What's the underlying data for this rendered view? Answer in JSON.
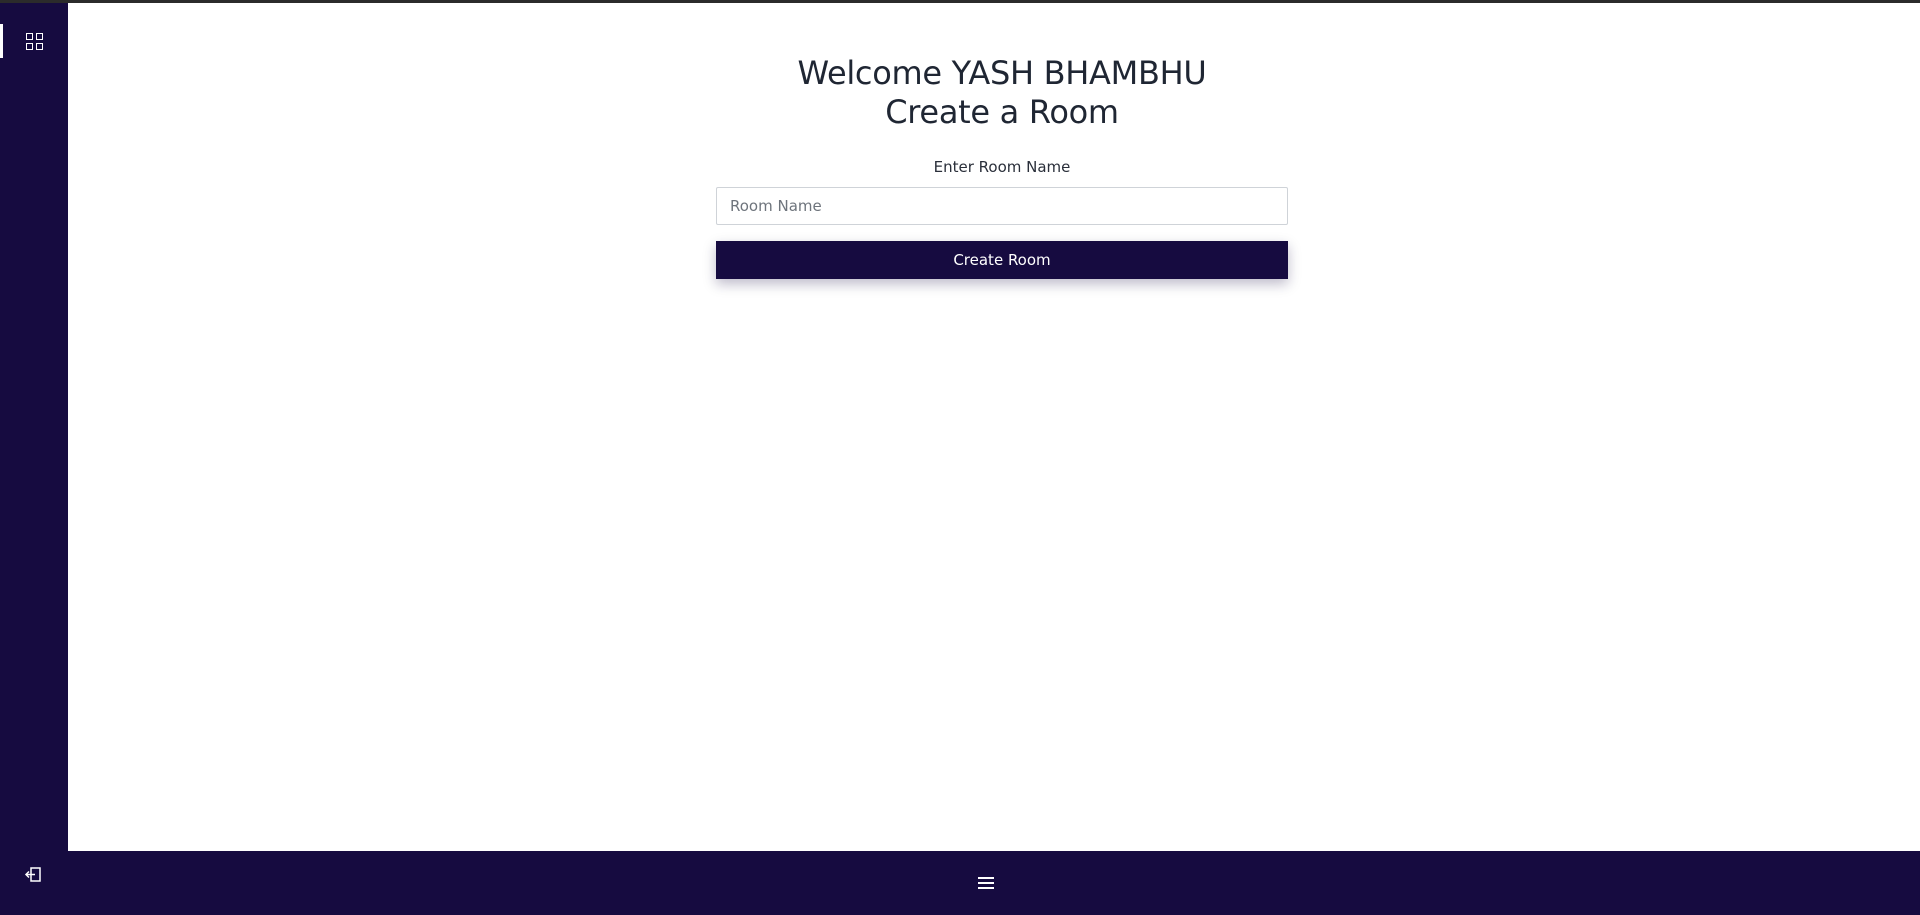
{
  "main": {
    "welcome_line": "Welcome YASH BHAMBHU",
    "heading_line": "Create a Room",
    "room_label": "Enter Room Name",
    "room_input": {
      "value": "",
      "placeholder": "Room Name"
    },
    "create_button_label": "Create Room"
  },
  "sidebar": {
    "items": [
      {
        "icon": "grid-icon",
        "active": true
      }
    ],
    "footer_icon": "logout-icon"
  },
  "bottom_bar": {
    "icon": "menu-icon"
  },
  "colors": {
    "brand_dark": "#160b40",
    "text": "#1f2633",
    "background": "#ffffff"
  }
}
